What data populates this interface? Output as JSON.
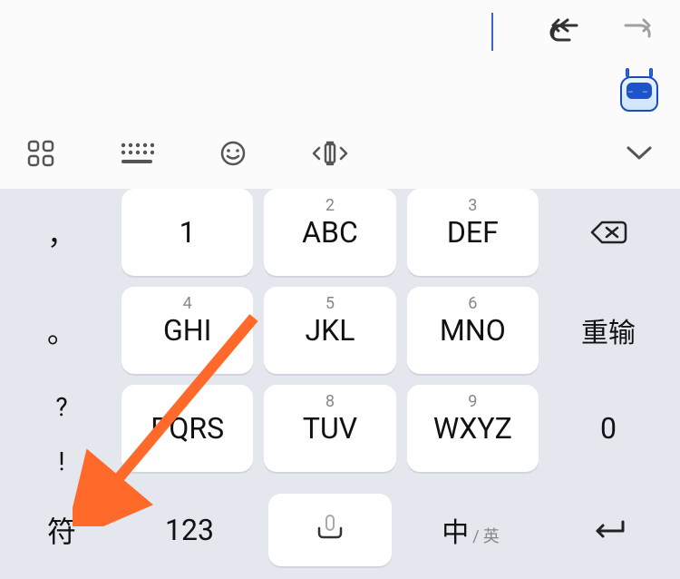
{
  "topbar": {
    "undo": "undo-icon",
    "redo": "redo-icon"
  },
  "toolbar": {
    "apps": "apps-icon",
    "keyboard_switch": "keyboard-icon",
    "emoji": "emoji-icon",
    "cursor_move": "cursor-move-icon",
    "collapse": "chevron-down-icon"
  },
  "left_column": {
    "comma": "，",
    "period": "。",
    "question": "?",
    "exclaim": "!"
  },
  "keys": {
    "r1": [
      {
        "sup": "",
        "main": "1"
      },
      {
        "sup": "2",
        "main": "ABC"
      },
      {
        "sup": "3",
        "main": "DEF"
      }
    ],
    "r2": [
      {
        "sup": "4",
        "main": "GHI"
      },
      {
        "sup": "5",
        "main": "JKL"
      },
      {
        "sup": "6",
        "main": "MNO"
      }
    ],
    "r3": [
      {
        "sup": "7",
        "main": "PQRS"
      },
      {
        "sup": "8",
        "main": "TUV"
      },
      {
        "sup": "9",
        "main": "WXYZ"
      }
    ]
  },
  "right_column": {
    "backspace": "backspace-icon",
    "reinput": "重输",
    "zero": "0"
  },
  "bottom": {
    "symbol": "符",
    "numbers": "123",
    "space": "space-mic-icon",
    "lang_cn": "中",
    "lang_slash": "/",
    "lang_en": "英",
    "enter": "enter-icon"
  }
}
